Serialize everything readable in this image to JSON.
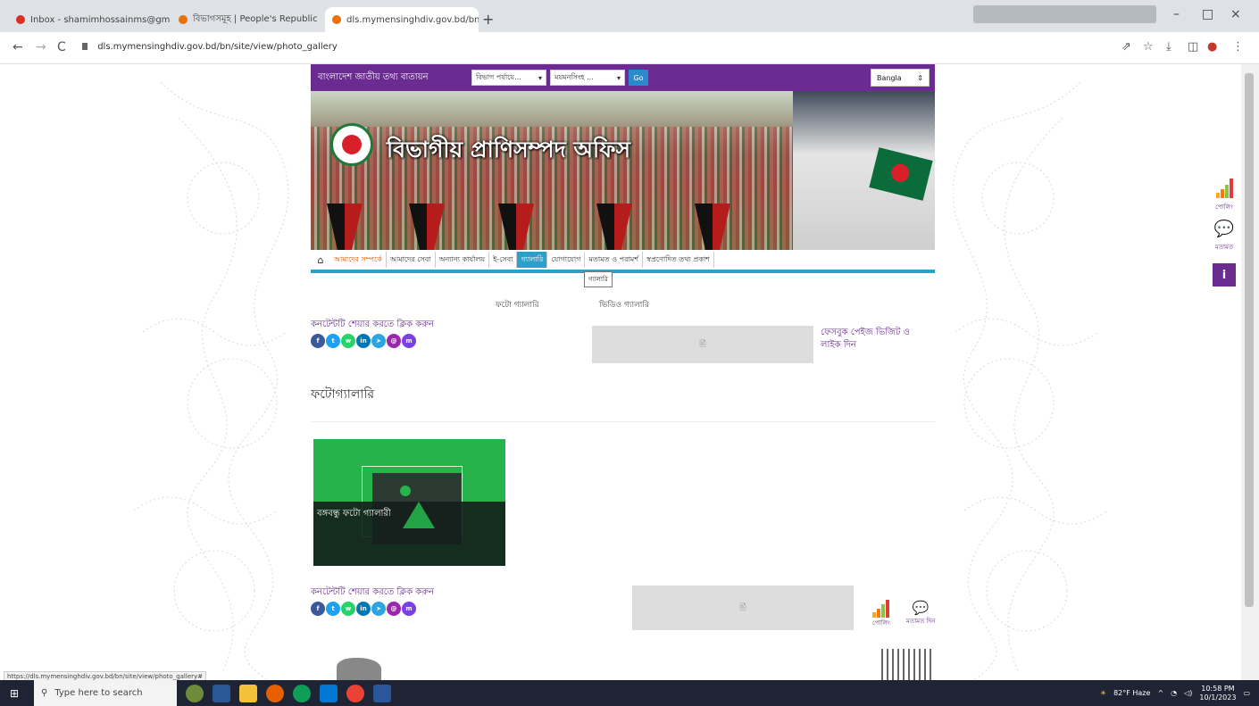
{
  "browser": {
    "tabs": [
      {
        "title": "Inbox - shamimhossainms@gm",
        "active": false,
        "color": "#d93025"
      },
      {
        "title": "বিভাগসমূহ | People's Republic",
        "active": false,
        "color": "#e8710a"
      },
      {
        "title": "dls.mymensinghdiv.gov.bd/bn/",
        "active": true,
        "color": "#e8710a"
      }
    ],
    "new_tab": "+",
    "url": "dls.mymensinghdiv.gov.bd/bn/site/view/photo_gallery",
    "nav": {
      "back": "←",
      "forward": "→",
      "reload": "C"
    },
    "window_controls": {
      "min": "–",
      "max": "□",
      "close": "×"
    },
    "toolbar_icons": [
      "share-icon",
      "star-icon",
      "download-icon",
      "sidebar-icon",
      "profile-icon",
      "menu-icon"
    ]
  },
  "site": {
    "portal_name": "বাংলাদেশ জাতীয় তথ্য বাতায়ন",
    "division_select": "বিভাগ পর্যায়ে...",
    "district_select": "ময়মনসিংহ ...",
    "go_label": "Go",
    "language_select": "Bangla",
    "banner_title": "বিভাগীয় প্রাণিসম্পদ অফিস",
    "menu": [
      {
        "label": "আমাদের সম্পর্কে",
        "state": "first"
      },
      {
        "label": "আমাদের সেবা",
        "state": ""
      },
      {
        "label": "অন্যান্য কার্যালয়",
        "state": ""
      },
      {
        "label": "ই-সেবা",
        "state": ""
      },
      {
        "label": "গ্যালারি",
        "state": "active"
      },
      {
        "label": "যোগাযোগ",
        "state": ""
      },
      {
        "label": "মতামত ও পরামর্শ",
        "state": ""
      },
      {
        "label": "স্বপ্রণোদিত তথ্য প্রকাশ",
        "state": ""
      }
    ],
    "menu_tooltip": "গ্যালারি",
    "subnav": {
      "photo": "ফটো গ্যালারি",
      "video": "ভিডিও গ্যালারি"
    },
    "share_label": "কনটেন্টটি শেয়ার করতে ক্লিক করুন",
    "share_icons": [
      {
        "name": "facebook-icon",
        "glyph": "f",
        "color": "#3b5998"
      },
      {
        "name": "twitter-icon",
        "glyph": "t",
        "color": "#1da1f2"
      },
      {
        "name": "whatsapp-icon",
        "glyph": "w",
        "color": "#25d366"
      },
      {
        "name": "linkedin-icon",
        "glyph": "in",
        "color": "#0077b5"
      },
      {
        "name": "telegram-icon",
        "glyph": "➤",
        "color": "#2ca5e0"
      },
      {
        "name": "email-icon",
        "glyph": "@",
        "color": "#9b27af"
      },
      {
        "name": "messenger-icon",
        "glyph": "m",
        "color": "#7b3fe4"
      }
    ],
    "facebook_widget_glyph": "🖹",
    "facebook_label": "ফেসবুক পেইজ ভিজিট ও লাইক দিন",
    "page_heading": "ফটোগ্যালারি",
    "gallery": [
      {
        "caption": "বঙ্গবন্ধু ফটো গ্যালারী"
      }
    ],
    "footer_poll_label": "পোলিং",
    "footer_feedback_label": "মতামত দিন"
  },
  "side_widgets": {
    "poll": "পোলিং",
    "feedback": "মতামত",
    "info": "i"
  },
  "status_url": "https://dls.mymensinghdiv.gov.bd/bn/site/view/photo_gallery#",
  "taskbar": {
    "search_placeholder": "Type here to search",
    "weather": "82°F Haze",
    "time": "10:58 PM",
    "date": "10/1/2023"
  }
}
